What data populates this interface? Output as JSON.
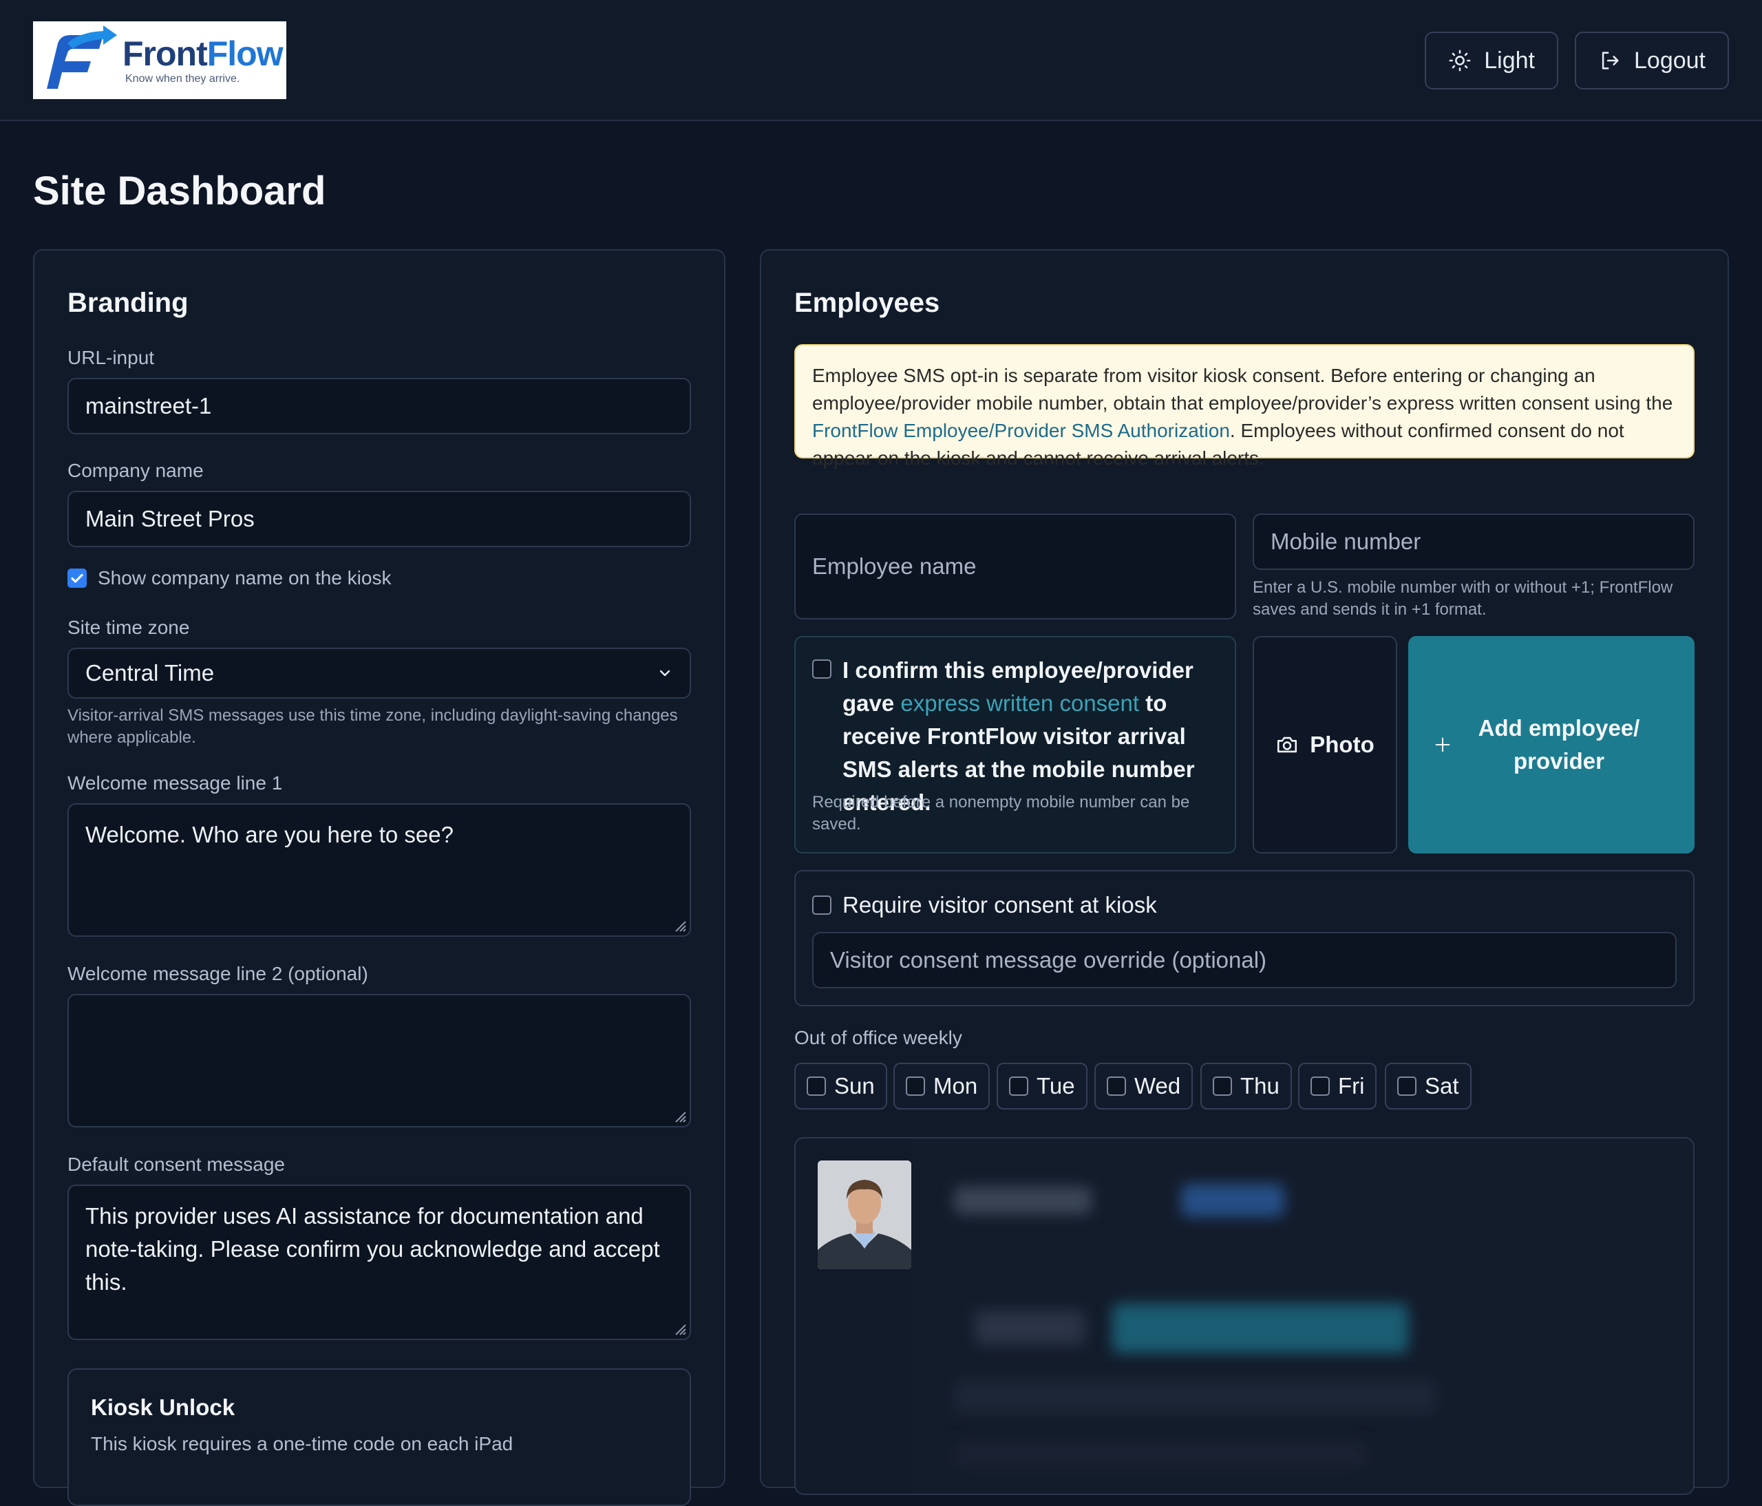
{
  "brand": {
    "name_part1": "Front",
    "name_part2": "Flow",
    "tagline": "Know when they arrive.",
    "primary_color": "#1f76d6",
    "accent_color": "#1d7b8f"
  },
  "header": {
    "theme_toggle_label": "Light",
    "theme_toggle_icon": "sun-icon",
    "logout_label": "Logout",
    "logout_icon": "logout-icon"
  },
  "page": {
    "title": "Site Dashboard"
  },
  "branding": {
    "title": "Branding",
    "url_label": "URL-input",
    "url_value": "mainstreet-1",
    "company_label": "Company name",
    "company_value": "Main Street Pros",
    "show_company_label": "Show company name on the kiosk",
    "show_company_checked": true,
    "timezone_label": "Site time zone",
    "timezone_value": "Central Time",
    "timezone_helper": "Visitor-arrival SMS messages use this time zone, including daylight-saving changes where applicable.",
    "welcome1_label": "Welcome message line 1",
    "welcome1_value": "Welcome. Who are you here to see?",
    "welcome2_label": "Welcome message line 2 (optional)",
    "welcome2_value": "",
    "consent_label": "Default consent message",
    "consent_value": "This provider uses AI assistance for documentation and note-taking. Please confirm you acknowledge and accept this.",
    "kiosk_unlock_title": "Kiosk Unlock",
    "kiosk_unlock_text": "This kiosk requires a one-time code on each iPad"
  },
  "employees": {
    "title": "Employees",
    "notice_part1": "Employee SMS opt-in is separate from visitor kiosk consent. Before entering or changing an employee/provider mobile number, obtain that employee/provider’s express written consent using the ",
    "notice_link": "FrontFlow Employee/Provider SMS Authorization",
    "notice_part2": ". Employees without confirmed consent do not appear on the kiosk and cannot receive arrival alerts.",
    "name_placeholder": "Employee name",
    "mobile_placeholder": "Mobile number",
    "mobile_helper": "Enter a U.S. mobile number with or without +1; FrontFlow saves and sends it in +1 format.",
    "consent_part1": "I confirm this employee/provider gave ",
    "consent_link": "express written consent",
    "consent_part2": " to receive FrontFlow visitor arrival SMS alerts at the mobile number entered.",
    "consent_helper": "Required before a nonempty mobile number can be saved.",
    "photo_label": "Photo",
    "photo_icon": "camera-icon",
    "add_label": "Add employee/ provider",
    "add_icon": "plus-icon",
    "require_consent_label": "Require visitor consent at kiosk",
    "consent_override_placeholder": "Visitor consent message override (optional)",
    "out_of_office_label": "Out of office weekly",
    "days": [
      "Sun",
      "Mon",
      "Tue",
      "Wed",
      "Thu",
      "Fri",
      "Sat"
    ]
  }
}
